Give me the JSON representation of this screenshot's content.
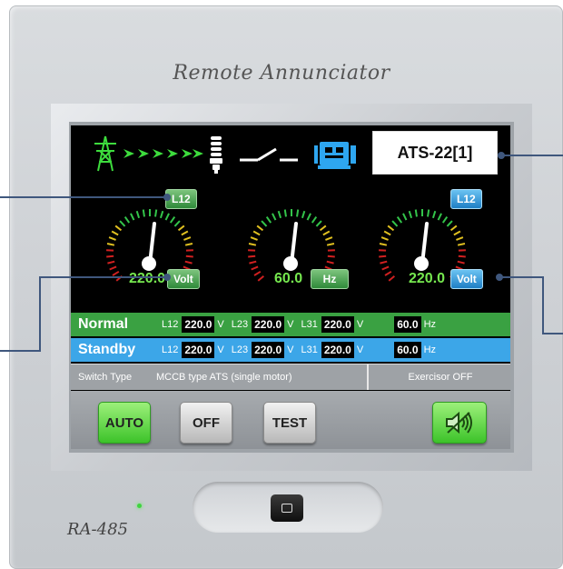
{
  "device": {
    "title": "Remote  Annunciator",
    "model": "RA-485"
  },
  "status": {
    "ats_label": "ATS-22[1]",
    "icons": [
      "transmission-tower-icon",
      "power-flow-arrows-icon",
      "bulb-icon",
      "transfer-switch-icon",
      "generator-icon"
    ]
  },
  "gauges": [
    {
      "id": "left",
      "button": "L12",
      "button_color": "#3a9a46",
      "unit_button": "Volt",
      "unit_color": "#3a9a46",
      "value": "220.0"
    },
    {
      "id": "center",
      "value": "60.0",
      "unit_button": "Hz",
      "unit_color": "#3a9a46"
    },
    {
      "id": "right",
      "button": "L12",
      "button_color": "#2e8fd6",
      "unit_button": "Volt",
      "unit_color": "#2e8fd6",
      "value": "220.0"
    }
  ],
  "sources": {
    "normal": {
      "name": "Normal",
      "l12_label": "L12",
      "l12": "220.0",
      "l23_label": "L23",
      "l23": "220.0",
      "l31_label": "L31",
      "l31": "220.0",
      "freq": "60.0",
      "v_unit": "V",
      "hz_unit": "Hz"
    },
    "standby": {
      "name": "Standby",
      "l12_label": "L12",
      "l12": "220.0",
      "l23_label": "L23",
      "l23": "220.0",
      "l31_label": "L31",
      "l31": "220.0",
      "freq": "60.0",
      "v_unit": "V",
      "hz_unit": "Hz"
    }
  },
  "info": {
    "switch_type_label": "Switch Type",
    "switch_type_value": "MCCB type ATS (single motor)",
    "exercisor": "Exercisor OFF"
  },
  "buttons": {
    "auto": "AUTO",
    "off": "OFF",
    "test": "TEST",
    "mute_icon": "speaker-mute-icon"
  },
  "colors": {
    "normal_bg": "#3aa142",
    "standby_bg": "#3ca6e8",
    "callout": "#3f577d"
  }
}
